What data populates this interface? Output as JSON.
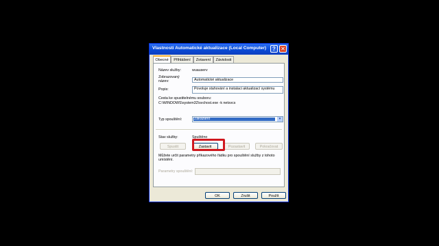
{
  "window": {
    "title": "Vlastnosti Automatické aktualizace (Local Computer)",
    "help_glyph": "?",
    "close_glyph": "✕"
  },
  "tabs": [
    {
      "label": "Obecné",
      "active": true
    },
    {
      "label": "Přihlášení",
      "active": false
    },
    {
      "label": "Zotavení",
      "active": false
    },
    {
      "label": "Závislosti",
      "active": false
    }
  ],
  "general": {
    "service_name_label": "Název služby:",
    "service_name_value": "wuauserv",
    "display_name_label_1": "Zobrazovaný",
    "display_name_label_2": "název:",
    "display_name_value": "Automatické aktualizace",
    "description_label": "Popis:",
    "description_value": "Povoluje stahování a instalaci aktualizací systému",
    "exec_path_label": "Cesta ke spustitelnému souboru:",
    "exec_path_value": "C:\\WINDOWS\\system32\\svchost.exe -k netsvcs",
    "startup_type_label": "Typ spouštění:",
    "startup_type_value": "Zakázáno",
    "status_label": "Stav služby:",
    "status_value": "Spuštěno",
    "start_button": "Spustit",
    "stop_button": "Zastavit",
    "pause_button": "Pozastavit",
    "resume_button": "Pokračovat",
    "params_hint_1": "Můžete určit parametry příkazového řádku pro spouštění služby z tohoto",
    "params_hint_2": "umístění.",
    "params_label": "Parametry spouštění:",
    "params_value": ""
  },
  "footer": {
    "ok": "OK",
    "cancel": "Zrušit",
    "apply": "Použít"
  },
  "colors": {
    "highlight_border": "#d0181f",
    "titlebar": "#0a4bd6"
  }
}
